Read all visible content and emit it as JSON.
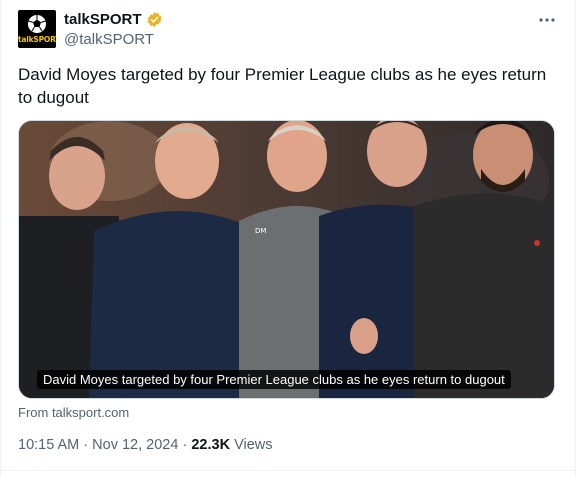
{
  "author": {
    "display_name": "talkSPORT",
    "handle": "@talkSPORT",
    "logo_text": "talkSPORT",
    "verified_icon": "verified-badge-icon",
    "verified_color": "#e8b229"
  },
  "tweet": {
    "text": "David Moyes targeted by four Premier League clubs as he eyes return to dugout",
    "more_icon": "more-icon"
  },
  "media": {
    "caption": "David Moyes targeted by four Premier League clubs as he eyes return to dugout",
    "source": "From talksport.com"
  },
  "meta": {
    "time": "10:15 AM",
    "date": "Nov 12, 2024",
    "separator": "·",
    "views_count": "22.3K",
    "views_label": "Views"
  }
}
